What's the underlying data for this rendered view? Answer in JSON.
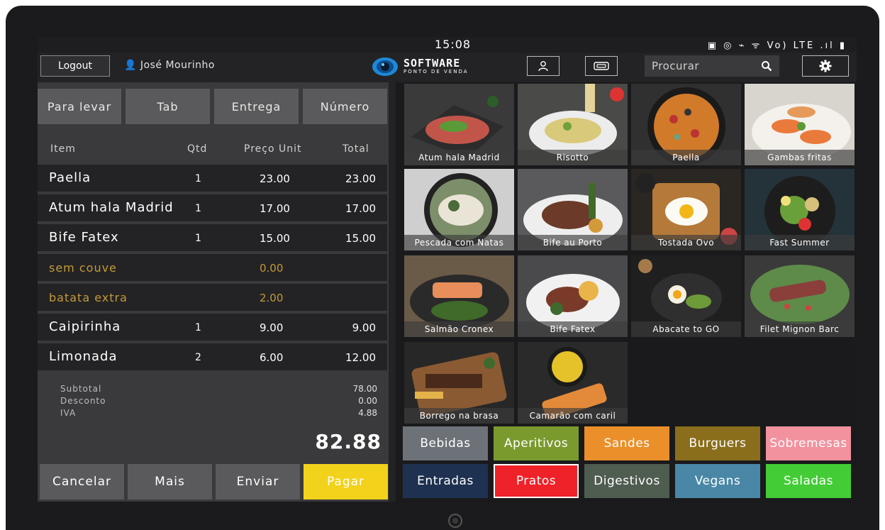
{
  "status": {
    "time": "15:08",
    "icons": "▣ ◎ ⌁ ᯤ Vo) LTE .ıl ▮"
  },
  "topbar": {
    "logout_label": "Logout",
    "user_name": "José Mourinho",
    "brand": "SOFTWARE",
    "brand_sub": "PONTO DE VENDA",
    "search_placeholder": "Procurar"
  },
  "order_types": [
    "Para levar",
    "Tab",
    "Entrega",
    "Número"
  ],
  "columns": {
    "item": "Item",
    "qty": "Qtd",
    "price": "Preço Unit",
    "total": "Total"
  },
  "order_items": [
    {
      "name": "Paella",
      "qty": "1",
      "price": "23.00",
      "total": "23.00"
    },
    {
      "name": "Atum hala Madrid",
      "qty": "1",
      "price": "17.00",
      "total": "17.00"
    },
    {
      "name": "Bife Fatex",
      "qty": "1",
      "price": "15.00",
      "total": "15.00"
    },
    {
      "name": "sem couve",
      "qty": "",
      "price": "0.00",
      "total": ""
    },
    {
      "name": "batata extra",
      "qty": "",
      "price": "2.00",
      "total": ""
    },
    {
      "name": "Caipirinha",
      "qty": "1",
      "price": "9.00",
      "total": "9.00"
    },
    {
      "name": "Limonada",
      "qty": "2",
      "price": "6.00",
      "total": "12.00"
    }
  ],
  "summary": {
    "subtotal_label": "Subtotal",
    "discount_label": "Desconto",
    "vat_label": "IVA",
    "subtotal": "78.00",
    "discount": "0.00",
    "vat": "4.88",
    "grand_total": "82.88"
  },
  "actions": [
    "Cancelar",
    "Mais",
    "Enviar",
    "Pagar"
  ],
  "products": [
    "Atum hala Madrid",
    "Risotto",
    "Paella",
    "Gambas fritas",
    "Pescada com Natas",
    "Bife au Porto",
    "Tostada Ovo",
    "Fast Summer",
    "Salmão Cronex",
    "Bife Fatex",
    "Abacate to GO",
    "Filet Mignon Barc",
    "Borrego na brasa",
    "Camarão com caril"
  ],
  "categories": [
    {
      "label": "Bebidas",
      "color": "#6d7278"
    },
    {
      "label": "Aperitivos",
      "color": "#7a9a2e"
    },
    {
      "label": "Sandes",
      "color": "#ea8f2a"
    },
    {
      "label": "Burguers",
      "color": "#8a6e1c"
    },
    {
      "label": "Sobremesas",
      "color": "#f2929e"
    },
    {
      "label": "Entradas",
      "color": "#1e3150"
    },
    {
      "label": "Pratos",
      "color": "#ee2228"
    },
    {
      "label": "Digestivos",
      "color": "#4f5c50"
    },
    {
      "label": "Vegans",
      "color": "#4a87a6"
    },
    {
      "label": "Saladas",
      "color": "#43cc36"
    }
  ],
  "colors": {
    "pay_button": "#f2d21b",
    "modifier_text": "#c49a38",
    "selected_category_border": "#ffffff"
  }
}
